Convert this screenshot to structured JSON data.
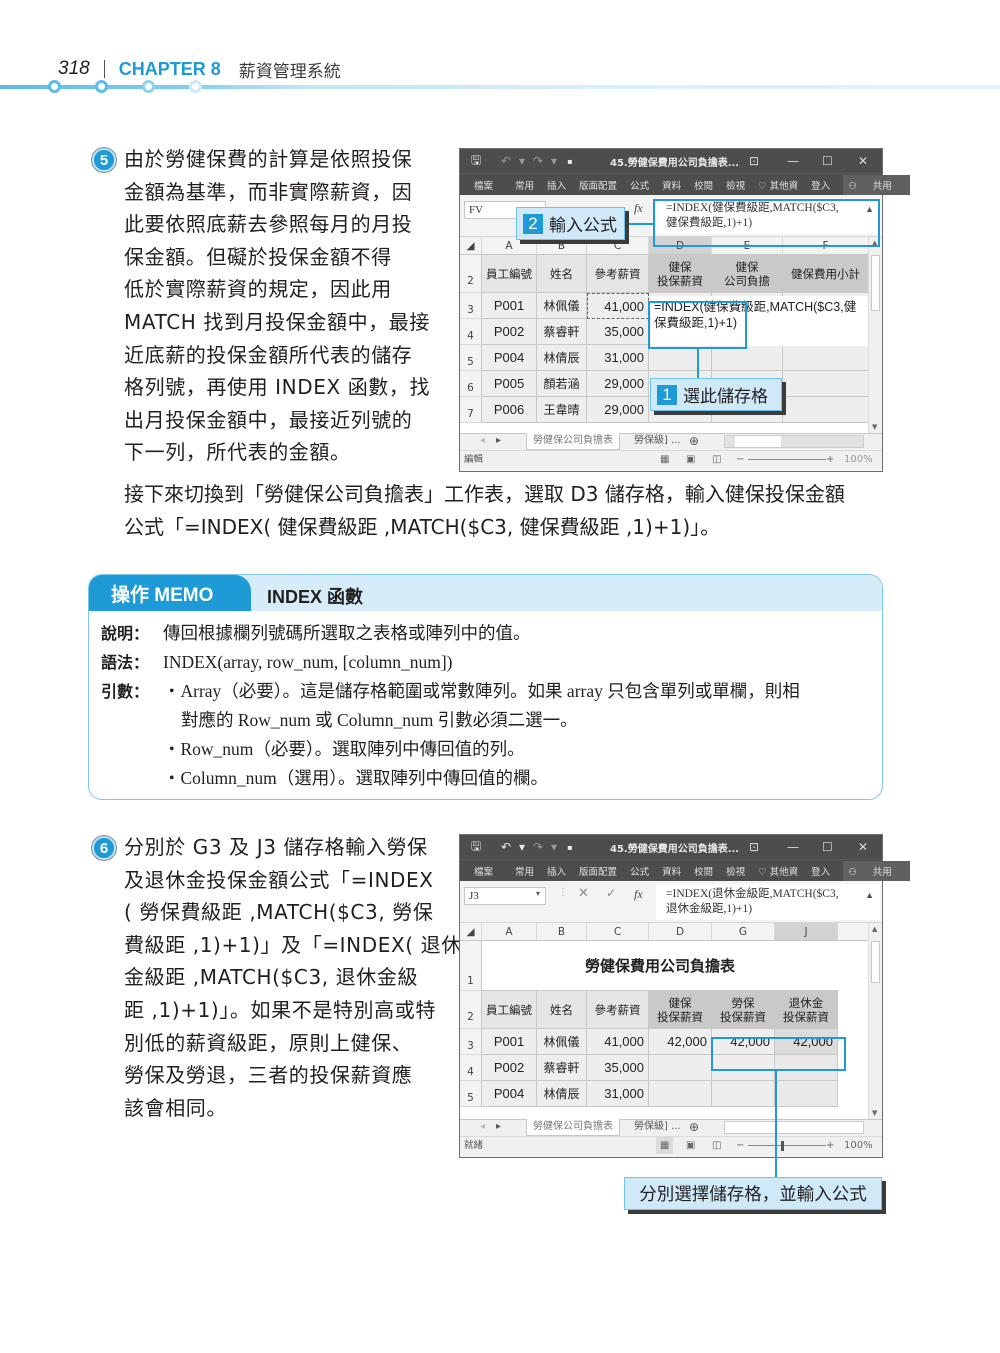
{
  "header": {
    "page_number": "318",
    "chapter": "CHAPTER 8",
    "chapter_title": "薪資管理系統"
  },
  "step5": {
    "badge": "5",
    "lines": [
      "由於勞健保費的計算是依照投保",
      "金額為基準，而非實際薪資，因",
      "此要依照底薪去參照每月的月投",
      "保金額。但礙於投保金額不得",
      "低於實際薪資的規定，因此用",
      "MATCH 找到月投保金額中，最接",
      "近底薪的投保金額所代表的儲存",
      "格列號，再使用 INDEX 函數，找",
      "出月投保金額中，最接近列號的",
      "下一列，所代表的金額。"
    ],
    "continuation": [
      "接下來切換到「勞健保公司負擔表」工作表，選取 D3 儲存格，輸入健保投保金額",
      "公式「=INDEX( 健保費級距 ,MATCH($C3, 健保費級距 ,1)+1)」。"
    ]
  },
  "excel1": {
    "window_title": "45.勞健保費用公司負擔表...",
    "ribbon_tabs": [
      "檔案",
      "常用",
      "插入",
      "版面配置",
      "公式",
      "資料",
      "校閱",
      "檢視",
      "♡ 其他資",
      "登入",
      "共用"
    ],
    "name_box": "FV",
    "formula_line1": "=INDEX(健保費級距,MATCH($C3,",
    "formula_line2": "健保費級距,1)+1)",
    "columns": [
      "A",
      "B",
      "C",
      "D",
      "E",
      "F"
    ],
    "header_row": {
      "row": "2",
      "cells": [
        "員工編號",
        "姓名",
        "參考薪資",
        "健保\n投保薪資",
        "健保\n公司負擔",
        "健保費用小計"
      ]
    },
    "rows": [
      {
        "row": "3",
        "id": "P001",
        "name": "林佩儀",
        "salary": "41,000"
      },
      {
        "row": "4",
        "id": "P002",
        "name": "蔡睿軒",
        "salary": "35,000"
      },
      {
        "row": "5",
        "id": "P004",
        "name": "林倩辰",
        "salary": "31,000"
      },
      {
        "row": "6",
        "id": "P005",
        "name": "顏若涵",
        "salary": "29,000"
      },
      {
        "row": "7",
        "id": "P006",
        "name": "王韋晴",
        "salary": "29,000"
      }
    ],
    "cell_edit_line1": "=INDEX(健保費級距,MATCH($C3,健",
    "cell_edit_line2": "保費級距,1)+1)",
    "sheet_tabs": [
      "勞健保公司負擔表",
      "勞保級] ..."
    ],
    "status": "編輯",
    "zoom": "100%",
    "callout_1": {
      "num": "1",
      "text": "選此儲存格"
    },
    "callout_2": {
      "num": "2",
      "text": "輸入公式"
    }
  },
  "memo": {
    "tag": "操作 MEMO",
    "title": "INDEX 函數",
    "desc_label": "說明：",
    "desc": "傳回根據欄列號碼所選取之表格或陣列中的值。",
    "syntax_label": "語法：",
    "syntax": "INDEX(array, row_num, [column_num])",
    "args_label": "引數：",
    "args": [
      "・Array（必要）。這是儲存格範圍或常數陣列。如果 array 只包含單列或單欄，則相",
      "對應的 Row_num 或 Column_num 引數必須二選一。",
      "・Row_num（必要）。選取陣列中傳回值的列。",
      "・Column_num（選用）。選取陣列中傳回值的欄。"
    ]
  },
  "step6": {
    "badge": "6",
    "lines": [
      "分別於 G3 及 J3 儲存格輸入勞保",
      "及退休金投保金額公式「=INDEX",
      "( 勞保費級距 ,MATCH($C3, 勞保",
      "費級距 ,1)+1)」及「=INDEX( 退休",
      "金級距 ,MATCH($C3, 退休金級",
      "距 ,1)+1)」。如果不是特別高或特",
      "別低的薪資級距，原則上健保、",
      "勞保及勞退，三者的投保薪資應",
      "該會相同。"
    ]
  },
  "excel2": {
    "window_title": "45.勞健保費用公司負擔表...",
    "ribbon_tabs": [
      "檔案",
      "常用",
      "插入",
      "版面配置",
      "公式",
      "資料",
      "校閱",
      "檢視",
      "♡ 其他資",
      "登入",
      "共用"
    ],
    "name_box": "J3",
    "formula_line1": "=INDEX(退休金級距,MATCH($C3,",
    "formula_line2": "退休金級距,1)+1)",
    "columns": [
      "A",
      "B",
      "C",
      "D",
      "G",
      "J"
    ],
    "title_row": {
      "row": "1",
      "text": "勞健保費用公司負擔表"
    },
    "header_row": {
      "row": "2",
      "cells": [
        "員工編號",
        "姓名",
        "參考薪資",
        "健保\n投保薪資",
        "勞保\n投保薪資",
        "退休金\n投保薪資"
      ]
    },
    "rows": [
      {
        "row": "3",
        "id": "P001",
        "name": "林佩儀",
        "salary": "41,000",
        "d": "42,000",
        "g": "42,000",
        "j": "42,000"
      },
      {
        "row": "4",
        "id": "P002",
        "name": "蔡睿軒",
        "salary": "35,000",
        "d": "",
        "g": "",
        "j": ""
      },
      {
        "row": "5",
        "id": "P004",
        "name": "林倩辰",
        "salary": "31,000",
        "d": "",
        "g": "",
        "j": ""
      }
    ],
    "sheet_tabs": [
      "勞健保公司負擔表",
      "勞保級] ..."
    ],
    "status": "就緒",
    "zoom": "100%",
    "callout": "分別選擇儲存格，並輸入公式"
  },
  "colors": {
    "accent": "#1e9ad6",
    "callout_bg": "#cfe9f8",
    "memo_head_bg": "#d6edf9",
    "excel_titlebar": "#4d4d4d"
  }
}
